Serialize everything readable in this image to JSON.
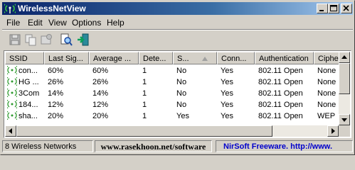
{
  "window": {
    "title": "WirelessNetView",
    "controls": [
      "minimize-icon",
      "maximize-icon",
      "close-icon"
    ]
  },
  "menu": {
    "items": [
      {
        "label": "File"
      },
      {
        "label": "Edit"
      },
      {
        "label": "View"
      },
      {
        "label": "Options"
      },
      {
        "label": "Help"
      }
    ]
  },
  "toolbar": {
    "icons": [
      "save-icon",
      "copy-icon",
      "properties-icon",
      "find-icon",
      "exit-icon"
    ]
  },
  "table": {
    "columns": [
      {
        "label": "SSID"
      },
      {
        "label": "Last Sig..."
      },
      {
        "label": "Average ..."
      },
      {
        "label": "Dete..."
      },
      {
        "label": "S..."
      },
      {
        "label": "Conn..."
      },
      {
        "label": "Authentication"
      },
      {
        "label": "Cipher"
      }
    ],
    "sorted_column": "S...",
    "rows": [
      {
        "ssid": "con...",
        "last_signal": "60%",
        "average": "60%",
        "detections": "1",
        "security": "No",
        "connectable": "Yes",
        "authentication": "802.11 Open",
        "cipher": "None"
      },
      {
        "ssid": "HG ...",
        "last_signal": "26%",
        "average": "26%",
        "detections": "1",
        "security": "No",
        "connectable": "Yes",
        "authentication": "802.11 Open",
        "cipher": "None"
      },
      {
        "ssid": "3Com",
        "last_signal": "14%",
        "average": "14%",
        "detections": "1",
        "security": "No",
        "connectable": "Yes",
        "authentication": "802.11 Open",
        "cipher": "None"
      },
      {
        "ssid": "184...",
        "last_signal": "12%",
        "average": "12%",
        "detections": "1",
        "security": "No",
        "connectable": "Yes",
        "authentication": "802.11 Open",
        "cipher": "None"
      },
      {
        "ssid": "sha...",
        "last_signal": "20%",
        "average": "20%",
        "detections": "1",
        "security": "Yes",
        "connectable": "Yes",
        "authentication": "802.11 Open",
        "cipher": "WEP"
      }
    ]
  },
  "status": {
    "count": "8 Wireless Networks",
    "url": "www.rasekhoon.net/software",
    "credit": "NirSoft Freeware.  http://www."
  },
  "colors": {
    "title_start": "#0a246a",
    "title_end": "#a6caf0",
    "wifi_icon": "#2e9a2e",
    "credit_link": "#0000cc"
  }
}
